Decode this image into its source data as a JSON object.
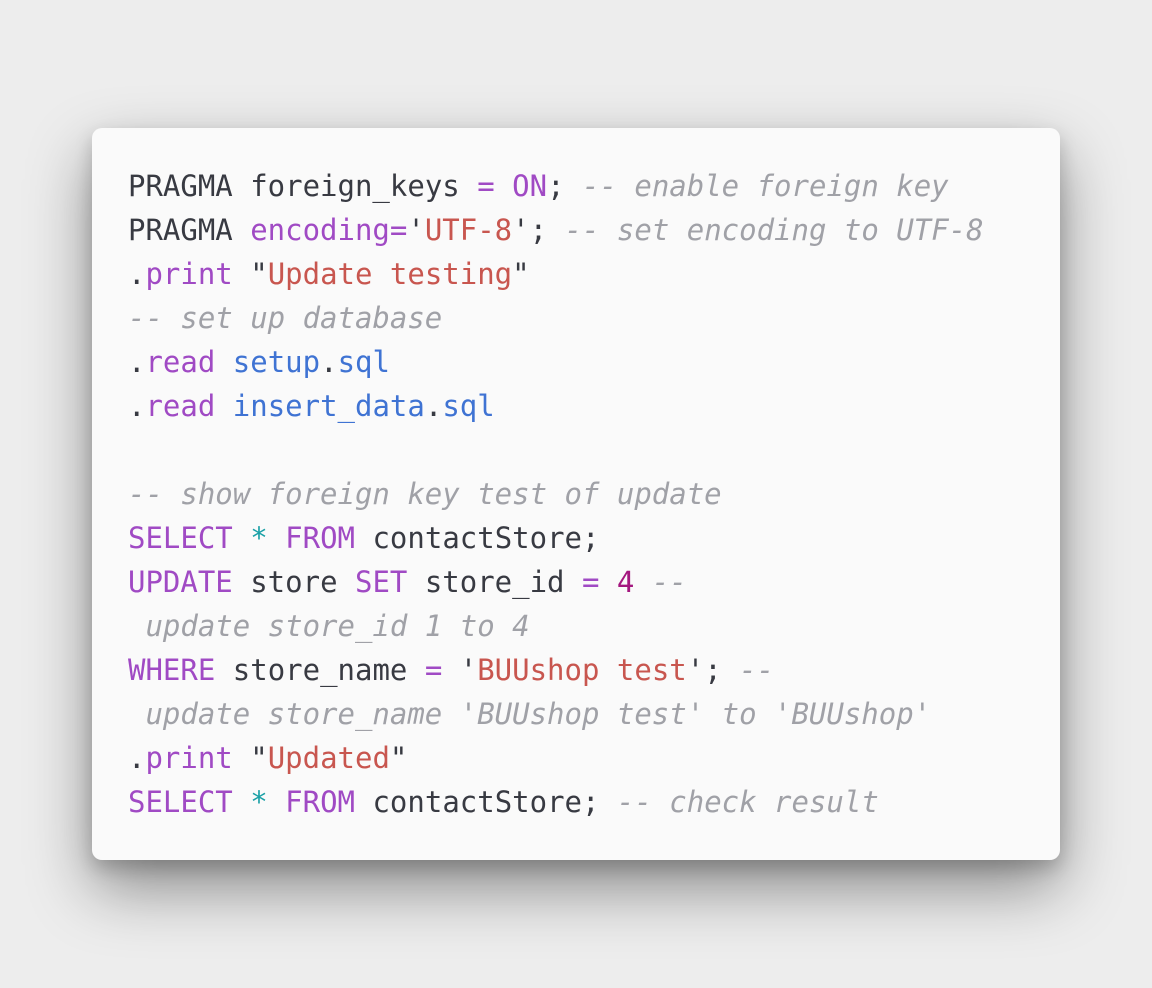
{
  "code_card": {
    "lines": [
      {
        "tokens": [
          {
            "text": "PRAGMA ",
            "kind": "plain"
          },
          {
            "text": "foreign_keys ",
            "kind": "plain"
          },
          {
            "text": "=",
            "kind": "operator"
          },
          {
            "text": " ",
            "kind": "plain"
          },
          {
            "text": "ON",
            "kind": "keyword"
          },
          {
            "text": "; ",
            "kind": "punct"
          },
          {
            "text": "-- enable foreign key",
            "kind": "comment"
          }
        ]
      },
      {
        "tokens": [
          {
            "text": "PRAGMA ",
            "kind": "plain"
          },
          {
            "text": "encoding",
            "kind": "keyword"
          },
          {
            "text": "=",
            "kind": "operator"
          },
          {
            "text": "'",
            "kind": "punct"
          },
          {
            "text": "UTF-8",
            "kind": "string"
          },
          {
            "text": "'",
            "kind": "punct"
          },
          {
            "text": "; ",
            "kind": "punct"
          },
          {
            "text": "-- set encoding to UTF-8",
            "kind": "comment"
          }
        ]
      },
      {
        "tokens": [
          {
            "text": ".",
            "kind": "punct"
          },
          {
            "text": "print",
            "kind": "keyword"
          },
          {
            "text": " \"",
            "kind": "punct"
          },
          {
            "text": "Update testing",
            "kind": "string"
          },
          {
            "text": "\"",
            "kind": "punct"
          }
        ]
      },
      {
        "tokens": [
          {
            "text": "-- set up database",
            "kind": "comment"
          }
        ]
      },
      {
        "tokens": [
          {
            "text": ".",
            "kind": "punct"
          },
          {
            "text": "read",
            "kind": "keyword"
          },
          {
            "text": " ",
            "kind": "plain"
          },
          {
            "text": "setup",
            "kind": "ident"
          },
          {
            "text": ".",
            "kind": "punct"
          },
          {
            "text": "sql",
            "kind": "ident"
          }
        ]
      },
      {
        "tokens": [
          {
            "text": ".",
            "kind": "punct"
          },
          {
            "text": "read",
            "kind": "keyword"
          },
          {
            "text": " ",
            "kind": "plain"
          },
          {
            "text": "insert_data",
            "kind": "ident"
          },
          {
            "text": ".",
            "kind": "punct"
          },
          {
            "text": "sql",
            "kind": "ident"
          }
        ]
      },
      {
        "tokens": []
      },
      {
        "tokens": [
          {
            "text": "-- show foreign key test of update",
            "kind": "comment"
          }
        ]
      },
      {
        "tokens": [
          {
            "text": "SELECT",
            "kind": "keyword"
          },
          {
            "text": " ",
            "kind": "plain"
          },
          {
            "text": "*",
            "kind": "star"
          },
          {
            "text": " ",
            "kind": "plain"
          },
          {
            "text": "FROM",
            "kind": "keyword"
          },
          {
            "text": " contactStore;",
            "kind": "plain"
          }
        ]
      },
      {
        "tokens": [
          {
            "text": "UPDATE",
            "kind": "keyword"
          },
          {
            "text": " store ",
            "kind": "plain"
          },
          {
            "text": "SET",
            "kind": "keyword"
          },
          {
            "text": " store_id ",
            "kind": "plain"
          },
          {
            "text": "=",
            "kind": "operator"
          },
          {
            "text": " ",
            "kind": "plain"
          },
          {
            "text": "4",
            "kind": "number"
          },
          {
            "text": " ",
            "kind": "plain"
          },
          {
            "text": "--",
            "kind": "comment"
          }
        ]
      },
      {
        "tokens": [
          {
            "text": " update store_id 1 to 4",
            "kind": "comment"
          }
        ]
      },
      {
        "tokens": [
          {
            "text": "WHERE",
            "kind": "keyword"
          },
          {
            "text": " store_name ",
            "kind": "plain"
          },
          {
            "text": "=",
            "kind": "operator"
          },
          {
            "text": " '",
            "kind": "punct"
          },
          {
            "text": "BUUshop test",
            "kind": "string"
          },
          {
            "text": "'",
            "kind": "punct"
          },
          {
            "text": "; ",
            "kind": "punct"
          },
          {
            "text": "--",
            "kind": "comment"
          }
        ]
      },
      {
        "tokens": [
          {
            "text": " update store_name 'BUUshop test' to 'BUUshop'",
            "kind": "comment"
          }
        ]
      },
      {
        "tokens": [
          {
            "text": ".",
            "kind": "punct"
          },
          {
            "text": "print",
            "kind": "keyword"
          },
          {
            "text": " \"",
            "kind": "punct"
          },
          {
            "text": "Updated",
            "kind": "string"
          },
          {
            "text": "\"",
            "kind": "punct"
          }
        ]
      },
      {
        "tokens": [
          {
            "text": "SELECT",
            "kind": "keyword"
          },
          {
            "text": " ",
            "kind": "plain"
          },
          {
            "text": "*",
            "kind": "star"
          },
          {
            "text": " ",
            "kind": "plain"
          },
          {
            "text": "FROM",
            "kind": "keyword"
          },
          {
            "text": " contactStore; ",
            "kind": "plain"
          },
          {
            "text": "-- check result",
            "kind": "comment"
          }
        ]
      }
    ]
  },
  "colors": {
    "page_background": "#ededed",
    "card_background": "#fafafa",
    "plain": "#383a42",
    "keyword": "#a04ac4",
    "string": "#c8564f",
    "number": "#a4177f",
    "star": "#1aa0a6",
    "identifier": "#3f73d3",
    "comment": "#a0a1a7"
  }
}
